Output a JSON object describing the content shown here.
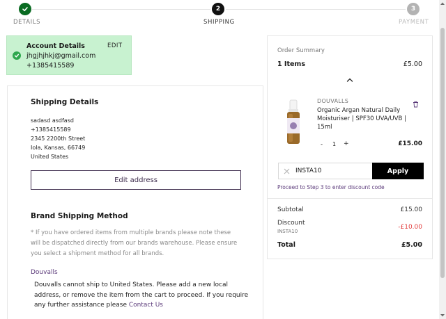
{
  "stepper": {
    "steps": [
      {
        "label": "DETAILS",
        "number": "",
        "state": "complete",
        "color": "#0a6b22"
      },
      {
        "label": "SHIPPING",
        "number": "2",
        "state": "active",
        "color": "#111111"
      },
      {
        "label": "PAYMENT",
        "number": "3",
        "state": "upcoming",
        "color": "#b3b3b3"
      }
    ]
  },
  "account": {
    "title": "Account Details",
    "edit_label": "EDIT",
    "email": "jhgjhjhkj@gmail.com",
    "phone": "+1385415589",
    "background": "#c8f2d0",
    "check_color": "#2ea84e"
  },
  "shipping": {
    "title": "Shipping Details",
    "address_lines": [
      "sadasd asdfasd",
      "+1385415589",
      "2345 2200th Street",
      "Iola, Kansas, 66749",
      "United States"
    ],
    "edit_address_label": "Edit address"
  },
  "brand_shipping": {
    "title": "Brand Shipping Method",
    "note_lines": [
      "* If you have ordered items from multiple brands please note these",
      "will be dispatched directly from our brands warehouse. Please ensure",
      "you select a shipment method for all brands."
    ],
    "brand_name": "Douvalls",
    "warning_lines": [
      "Douvalls cannot ship to United States. Please add a new local",
      "address, or remove the item from the cart to proceed. If you require"
    ],
    "warning_last_prefix": "any further assistance please ",
    "contact_link": "Contact Us"
  },
  "summary": {
    "title": "Order Summary",
    "items_label": "1 Items",
    "items_total": "£5.00",
    "product": {
      "brand": "DOUVALLS",
      "name_lines": [
        "Organic Argan Natural Daily",
        "Moisturiser | SPF30 UVA/UVB |",
        "15ml"
      ],
      "quantity": "1",
      "minus": "-",
      "plus": "+",
      "price": "£15.00"
    },
    "discount_code": "INSTA10",
    "apply_label": "Apply",
    "discount_hint": "Proceed to Step 3 to enter discount code",
    "subtotal_label": "Subtotal",
    "subtotal_value": "£15.00",
    "discount_label": "Discount",
    "discount_code_small": "INSTA10",
    "discount_value": "-£10.00",
    "total_label": "Total",
    "total_value": "£5.00",
    "discount_color": "#e23b3b",
    "link_color": "#5b3a7a"
  }
}
